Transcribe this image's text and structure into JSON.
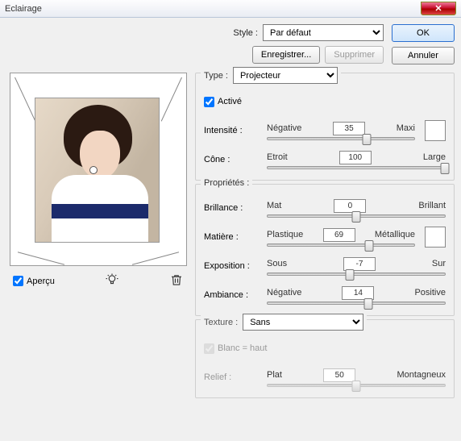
{
  "window": {
    "title": "Eclairage"
  },
  "style": {
    "label": "Style :",
    "value": "Par défaut",
    "save_label": "Enregistrer...",
    "delete_label": "Supprimer"
  },
  "buttons": {
    "ok": "OK",
    "cancel": "Annuler"
  },
  "type_panel": {
    "label": "Type :",
    "value": "Projecteur",
    "active_label": "Activé",
    "active_checked": true,
    "intensity": {
      "label": "Intensité :",
      "left": "Négative",
      "right": "Maxi",
      "value": 35,
      "min": -100,
      "max": 100
    },
    "cone": {
      "label": "Cône :",
      "left": "Etroit",
      "right": "Large",
      "value": 100,
      "min": 0,
      "max": 100
    }
  },
  "props_panel": {
    "label": "Propriétés :",
    "gloss": {
      "label": "Brillance :",
      "left": "Mat",
      "right": "Brillant",
      "value": 0,
      "min": -100,
      "max": 100
    },
    "material": {
      "label": "Matière :",
      "left": "Plastique",
      "right": "Métallique",
      "value": 69,
      "min": 0,
      "max": 100
    },
    "exposure": {
      "label": "Exposition :",
      "left": "Sous",
      "right": "Sur",
      "value": -7,
      "min": -100,
      "max": 100
    },
    "ambience": {
      "label": "Ambiance :",
      "left": "Négative",
      "right": "Positive",
      "value": 14,
      "min": -100,
      "max": 100
    }
  },
  "texture_panel": {
    "label": "Texture :",
    "value": "Sans",
    "white_high_label": "Blanc = haut",
    "relief": {
      "label": "Relief :",
      "left": "Plat",
      "right": "Montagneux",
      "value": 50,
      "min": 0,
      "max": 100
    }
  },
  "preview": {
    "label": "Aperçu",
    "checked": true
  },
  "icons": {
    "bulb": "bulb-icon",
    "trash": "trash-icon",
    "close": "close-icon"
  }
}
